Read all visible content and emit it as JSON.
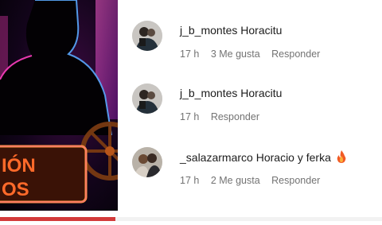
{
  "comments": [
    {
      "username": "j_b_montes",
      "text": "Horacitu",
      "time": "17 h",
      "likes": "3 Me gusta",
      "reply_label": "Responder",
      "emoji": null
    },
    {
      "username": "j_b_montes",
      "text": "Horacitu",
      "time": "17 h",
      "likes": null,
      "reply_label": "Responder",
      "emoji": null
    },
    {
      "username": "_salazarmarco",
      "text": "Horacio y ferka",
      "time": "17 h",
      "likes": "2 Me gusta",
      "reply_label": "Responder",
      "emoji": "fire-emoji"
    }
  ],
  "media": {
    "sign_text_top": "IÓN",
    "sign_text_bottom": "OS",
    "accent_colors": {
      "neon_pink": "#ff3fc0",
      "neon_blue": "#5aa8ff",
      "sign_orange": "#e0701a"
    }
  }
}
